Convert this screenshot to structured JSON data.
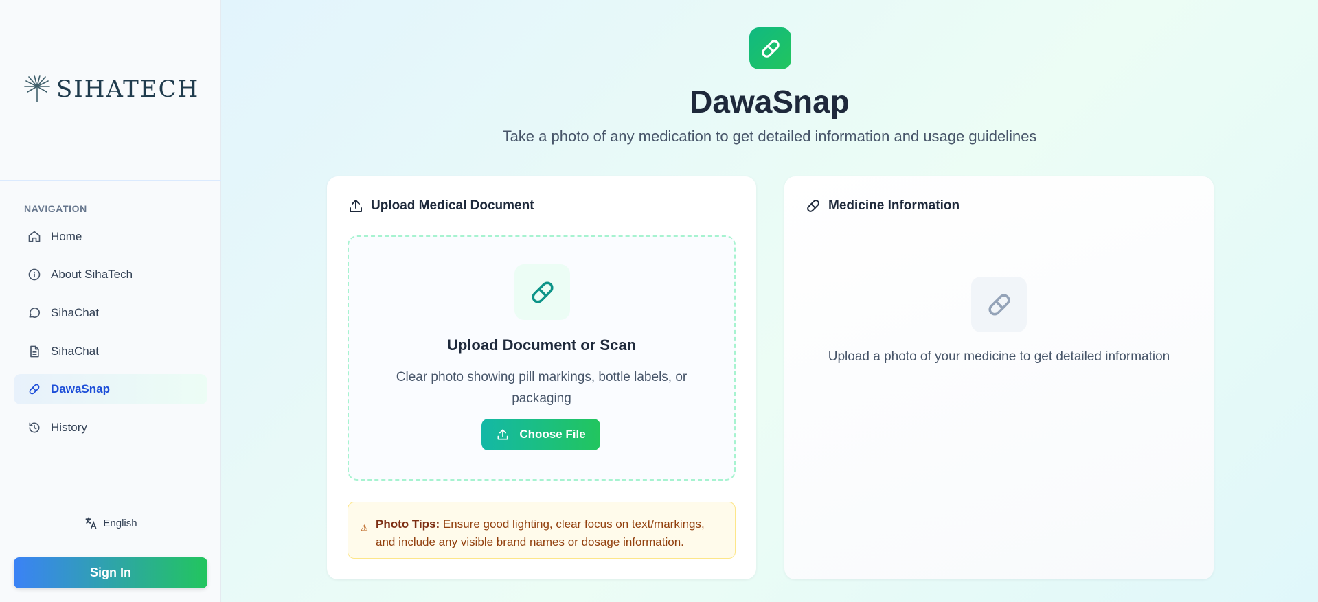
{
  "sidebar": {
    "logo_text": "SIHATECH",
    "nav_title": "NAVIGATION",
    "items": [
      {
        "label": "Home",
        "icon": "home-icon"
      },
      {
        "label": "About SihaTech",
        "icon": "info-icon"
      },
      {
        "label": "SihaChat",
        "icon": "chat-bubble-icon"
      },
      {
        "label": "SihaChat",
        "icon": "document-icon"
      },
      {
        "label": "DawaSnap",
        "icon": "pill-icon",
        "active": true
      },
      {
        "label": "History",
        "icon": "history-icon"
      }
    ],
    "language": "English",
    "sign_in_label": "Sign In"
  },
  "header": {
    "title": "DawaSnap",
    "subtitle": "Take a photo of any medication to get detailed information and usage guidelines"
  },
  "upload_card": {
    "title": "Upload Medical Document",
    "dropzone_title": "Upload Document or Scan",
    "dropzone_description": "Clear photo showing pill markings, bottle labels, or packaging",
    "choose_file_label": "Choose File",
    "tips_label": "Photo Tips:",
    "tips_text": "Ensure good lighting, clear focus on text/markings, and include any visible brand names or dosage information."
  },
  "info_card": {
    "title": "Medicine Information",
    "empty_text": "Upload a photo of your medicine to get detailed information"
  },
  "colors": {
    "accent_green": "#22c55e",
    "accent_blue": "#3b82f6",
    "active_nav": "#1d4ed8",
    "tips_bg": "#fffbeb"
  }
}
